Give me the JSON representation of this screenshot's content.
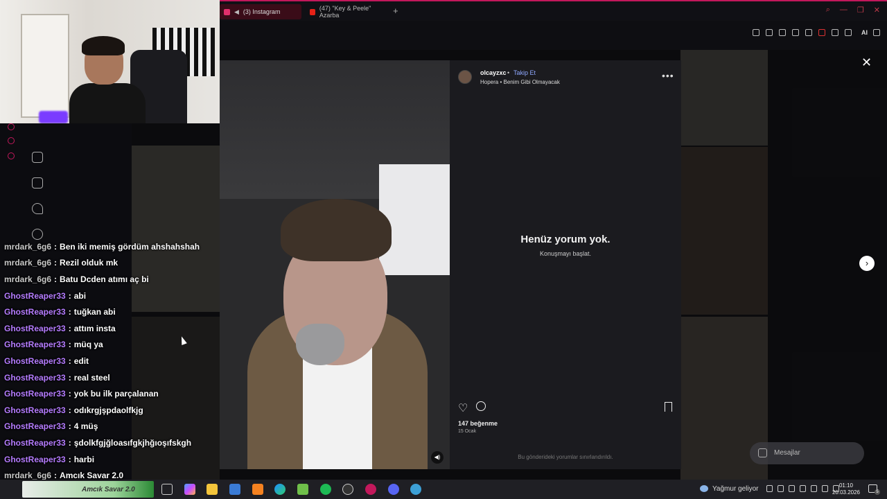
{
  "browser": {
    "tabs": [
      {
        "label": "(3) Instagram",
        "icon": "instagram-icon",
        "active": true
      },
      {
        "label": "(47) \"Key & Peele\" Azarba",
        "icon": "youtube-icon",
        "active": false
      }
    ],
    "new_tab_label": "+",
    "toolbar_ai_label": "AI",
    "accent_color": "#c2185b"
  },
  "post": {
    "username": "olcayzxc",
    "separator": "•",
    "follow_label": "Takip Et",
    "audio": "Hopera • Benim Gibi Olmayacak",
    "more_label": "•••",
    "empty_title": "Henüz yorum yok.",
    "empty_subtitle": "Konuşmayı başlat.",
    "likes": "147 beğenme",
    "date": "15 Ocak",
    "comments_limited": "Bu gönderideki yorumlar sınırlandırıldı.",
    "close_label": "✕",
    "next_label": "›",
    "volume_icon": "speaker-icon"
  },
  "messages": {
    "label": "Mesajlar"
  },
  "chat": {
    "lines": [
      {
        "user": "mrdark_6g6",
        "sep": ":",
        "msg": "Ben iki memiş gördüm ahshahshah",
        "color": "#c8c8c8"
      },
      {
        "user": "mrdark_6g6",
        "sep": ":",
        "msg": "Rezil olduk mk",
        "color": "#c8c8c8"
      },
      {
        "user": "mrdark_6g6",
        "sep": ":",
        "msg": "Batu Dcden atımı aç bi",
        "color": "#c8c8c8"
      },
      {
        "user": "GhostReaper33",
        "sep": ":",
        "msg": "abi",
        "color": "#b57cff"
      },
      {
        "user": "GhostReaper33",
        "sep": ":",
        "msg": "tuğkan abi",
        "color": "#b57cff"
      },
      {
        "user": "GhostReaper33",
        "sep": ":",
        "msg": "attım insta",
        "color": "#b57cff"
      },
      {
        "user": "GhostReaper33",
        "sep": ":",
        "msg": "müq ya",
        "color": "#b57cff"
      },
      {
        "user": "GhostReaper33",
        "sep": ":",
        "msg": "edit",
        "color": "#b57cff"
      },
      {
        "user": "GhostReaper33",
        "sep": ":",
        "msg": "real steel",
        "color": "#b57cff"
      },
      {
        "user": "GhostReaper33",
        "sep": ":",
        "msg": "yok bu ilk parçalanan",
        "color": "#b57cff"
      },
      {
        "user": "GhostReaper33",
        "sep": ":",
        "msg": "odıkrgjşpdaolfkjg",
        "color": "#b57cff"
      },
      {
        "user": "GhostReaper33",
        "sep": ":",
        "msg": "4 müş",
        "color": "#b57cff"
      },
      {
        "user": "GhostReaper33",
        "sep": ":",
        "msg": "şdolkfgjğloasıfgkjhğıoşıfskgh",
        "color": "#b57cff"
      },
      {
        "user": "GhostReaper33",
        "sep": ":",
        "msg": "harbi",
        "color": "#b57cff"
      },
      {
        "user": "mrdark_6g6",
        "sep": ":",
        "msg": "Amcık Savar 2.0",
        "color": "#c8c8c8"
      }
    ]
  },
  "taskbar": {
    "banner": "Amcık Savar 2.0",
    "weather": "Yağmur geliyor",
    "time": "01:10",
    "date": "20.03.2026",
    "notification_count": "5"
  }
}
